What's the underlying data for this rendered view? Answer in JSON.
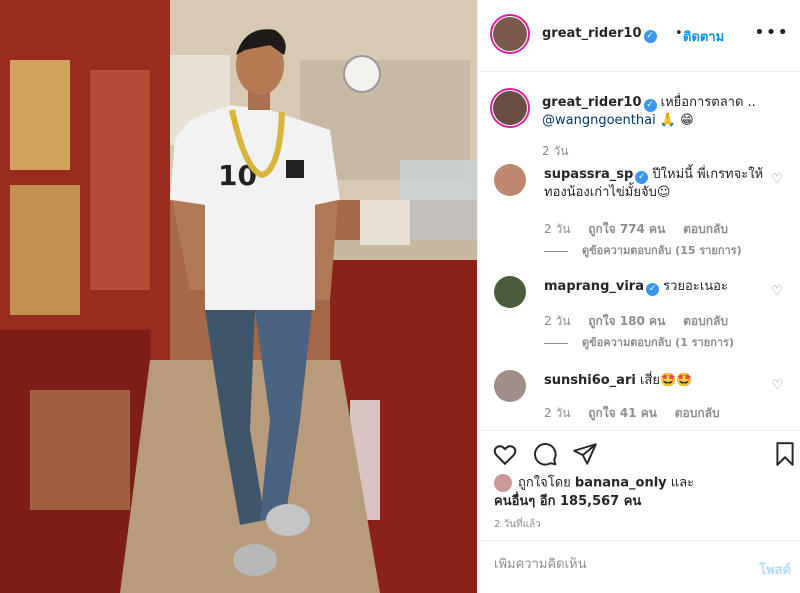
{
  "header": {
    "username": "great_rider10",
    "verified_mark": "✓",
    "dot": "•",
    "follow_label": "ติดตาม",
    "more_label": "•••"
  },
  "caption": {
    "username": "great_rider10",
    "text": "เหยื่อการตลาด ..",
    "mention": "@wangngoenthai",
    "emoji": "🙏 😁",
    "time": "2 วัน"
  },
  "comments": [
    {
      "username": "supassra_sp",
      "text": "ปีใหม่นี้ พี่เกรทจะให้ทองน้องเก่าไข่มั้ยจับ☺",
      "time": "2 วัน",
      "likes": "ถูกใจ 774 คน",
      "reply": "ตอบกลับ",
      "view_replies": "ดูข้อความตอบกลับ (15 รายการ)"
    },
    {
      "username": "maprang_vira",
      "text": "รวยอะเนอะ",
      "time": "2 วัน",
      "likes": "ถูกใจ 180 คน",
      "reply": "ตอบกลับ",
      "view_replies": "ดูข้อความตอบกลับ (1 รายการ)"
    },
    {
      "username": "sunshi6o_ari",
      "text": "เสี่ย🤩🤩",
      "time": "2 วัน",
      "likes": "ถูกใจ 41 คน",
      "reply": "ตอบกลับ"
    }
  ],
  "likes": {
    "prefix": "ถูกใจโดย",
    "user": "banana_only",
    "and": "และ",
    "others_label": "คนอื่นๆ อีก 185,567 คน"
  },
  "time_ago": "2 วันที่แล้ว",
  "add_comment": {
    "placeholder": "เพิ่มความคิดเห็น",
    "post_label": "โพสต์"
  },
  "icons": [
    "heart-icon",
    "comment-icon",
    "share-icon",
    "bookmark-icon",
    "verified-icon",
    "more-icon"
  ],
  "colors": {
    "accent": "#0095f6",
    "verified": "#3897f0",
    "text": "#262626",
    "muted": "#8e8e8e"
  }
}
